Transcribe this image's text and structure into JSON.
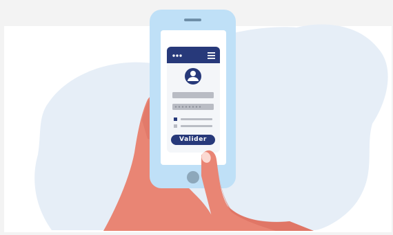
{
  "login_form": {
    "submit_label": "Valider",
    "password_mask": "••••••••"
  },
  "colors": {
    "navy": "#27397a",
    "phone_frame": "#bfe0f7",
    "blob": "#e6eef7",
    "skin": "#e98574",
    "skin_dark": "#d9695b",
    "field": "#b9bcc4"
  },
  "icons": [
    "menu-dots-icon",
    "hamburger-menu-icon",
    "user-avatar-icon",
    "checkbox-icon"
  ]
}
